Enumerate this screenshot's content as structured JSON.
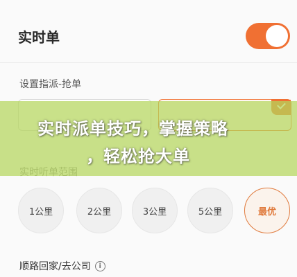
{
  "header": {
    "title": "实时单",
    "toggle_on": true
  },
  "assign_section": {
    "label": "设置指派-抢单",
    "selected_index": 1
  },
  "radius_section": {
    "label": "实时听单范围",
    "options": [
      "1公里",
      "2公里",
      "3公里",
      "5公里",
      "最优"
    ],
    "selected_index": 4
  },
  "route_section": {
    "label": "顺路回家/去公司",
    "info_icon": "ⓘ"
  },
  "overlay": {
    "line1": "实时派单技巧，掌握策略",
    "line2": "，轻松抢大单"
  },
  "colors": {
    "accent": "#f07033",
    "overlay": "#b4d65c"
  }
}
